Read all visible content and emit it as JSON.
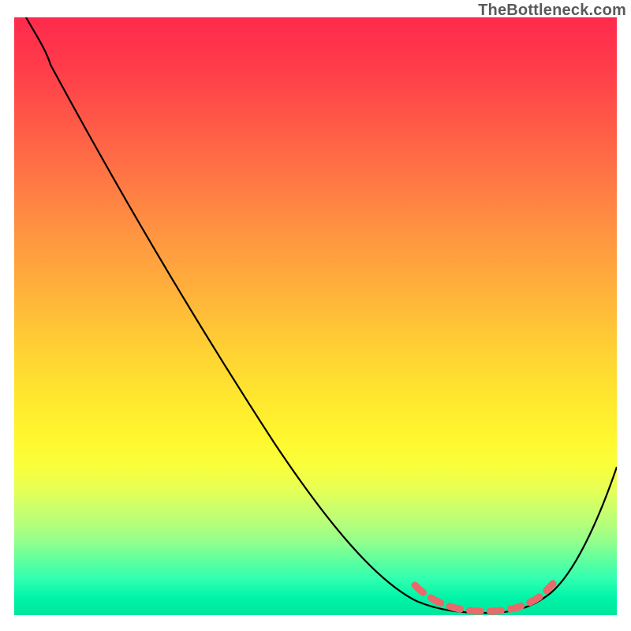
{
  "watermark": "TheBottleneck.com",
  "chart_data": {
    "type": "line",
    "title": "",
    "xlabel": "",
    "ylabel": "",
    "xlim": [
      0,
      100
    ],
    "ylim": [
      0,
      100
    ],
    "grid": false,
    "legend": false,
    "series": [
      {
        "name": "bottleneck-curve",
        "x": [
          2,
          6,
          14,
          22,
          30,
          38,
          46,
          54,
          62,
          66,
          70,
          74,
          78,
          82,
          86,
          92,
          100
        ],
        "y": [
          100,
          97,
          85,
          72,
          59,
          46,
          33,
          21,
          9,
          5,
          2,
          0,
          0,
          0,
          2,
          10,
          28
        ]
      },
      {
        "name": "optimal-range-highlight",
        "x": [
          66,
          70,
          74,
          78,
          82,
          86
        ],
        "y": [
          5,
          2,
          0,
          0,
          0,
          2
        ]
      }
    ],
    "colors": {
      "curve": "#000000",
      "highlight": "#e86a6a",
      "gradient_top": "#ff2a4d",
      "gradient_mid": "#ffe82e",
      "gradient_bottom": "#00e59c"
    }
  }
}
